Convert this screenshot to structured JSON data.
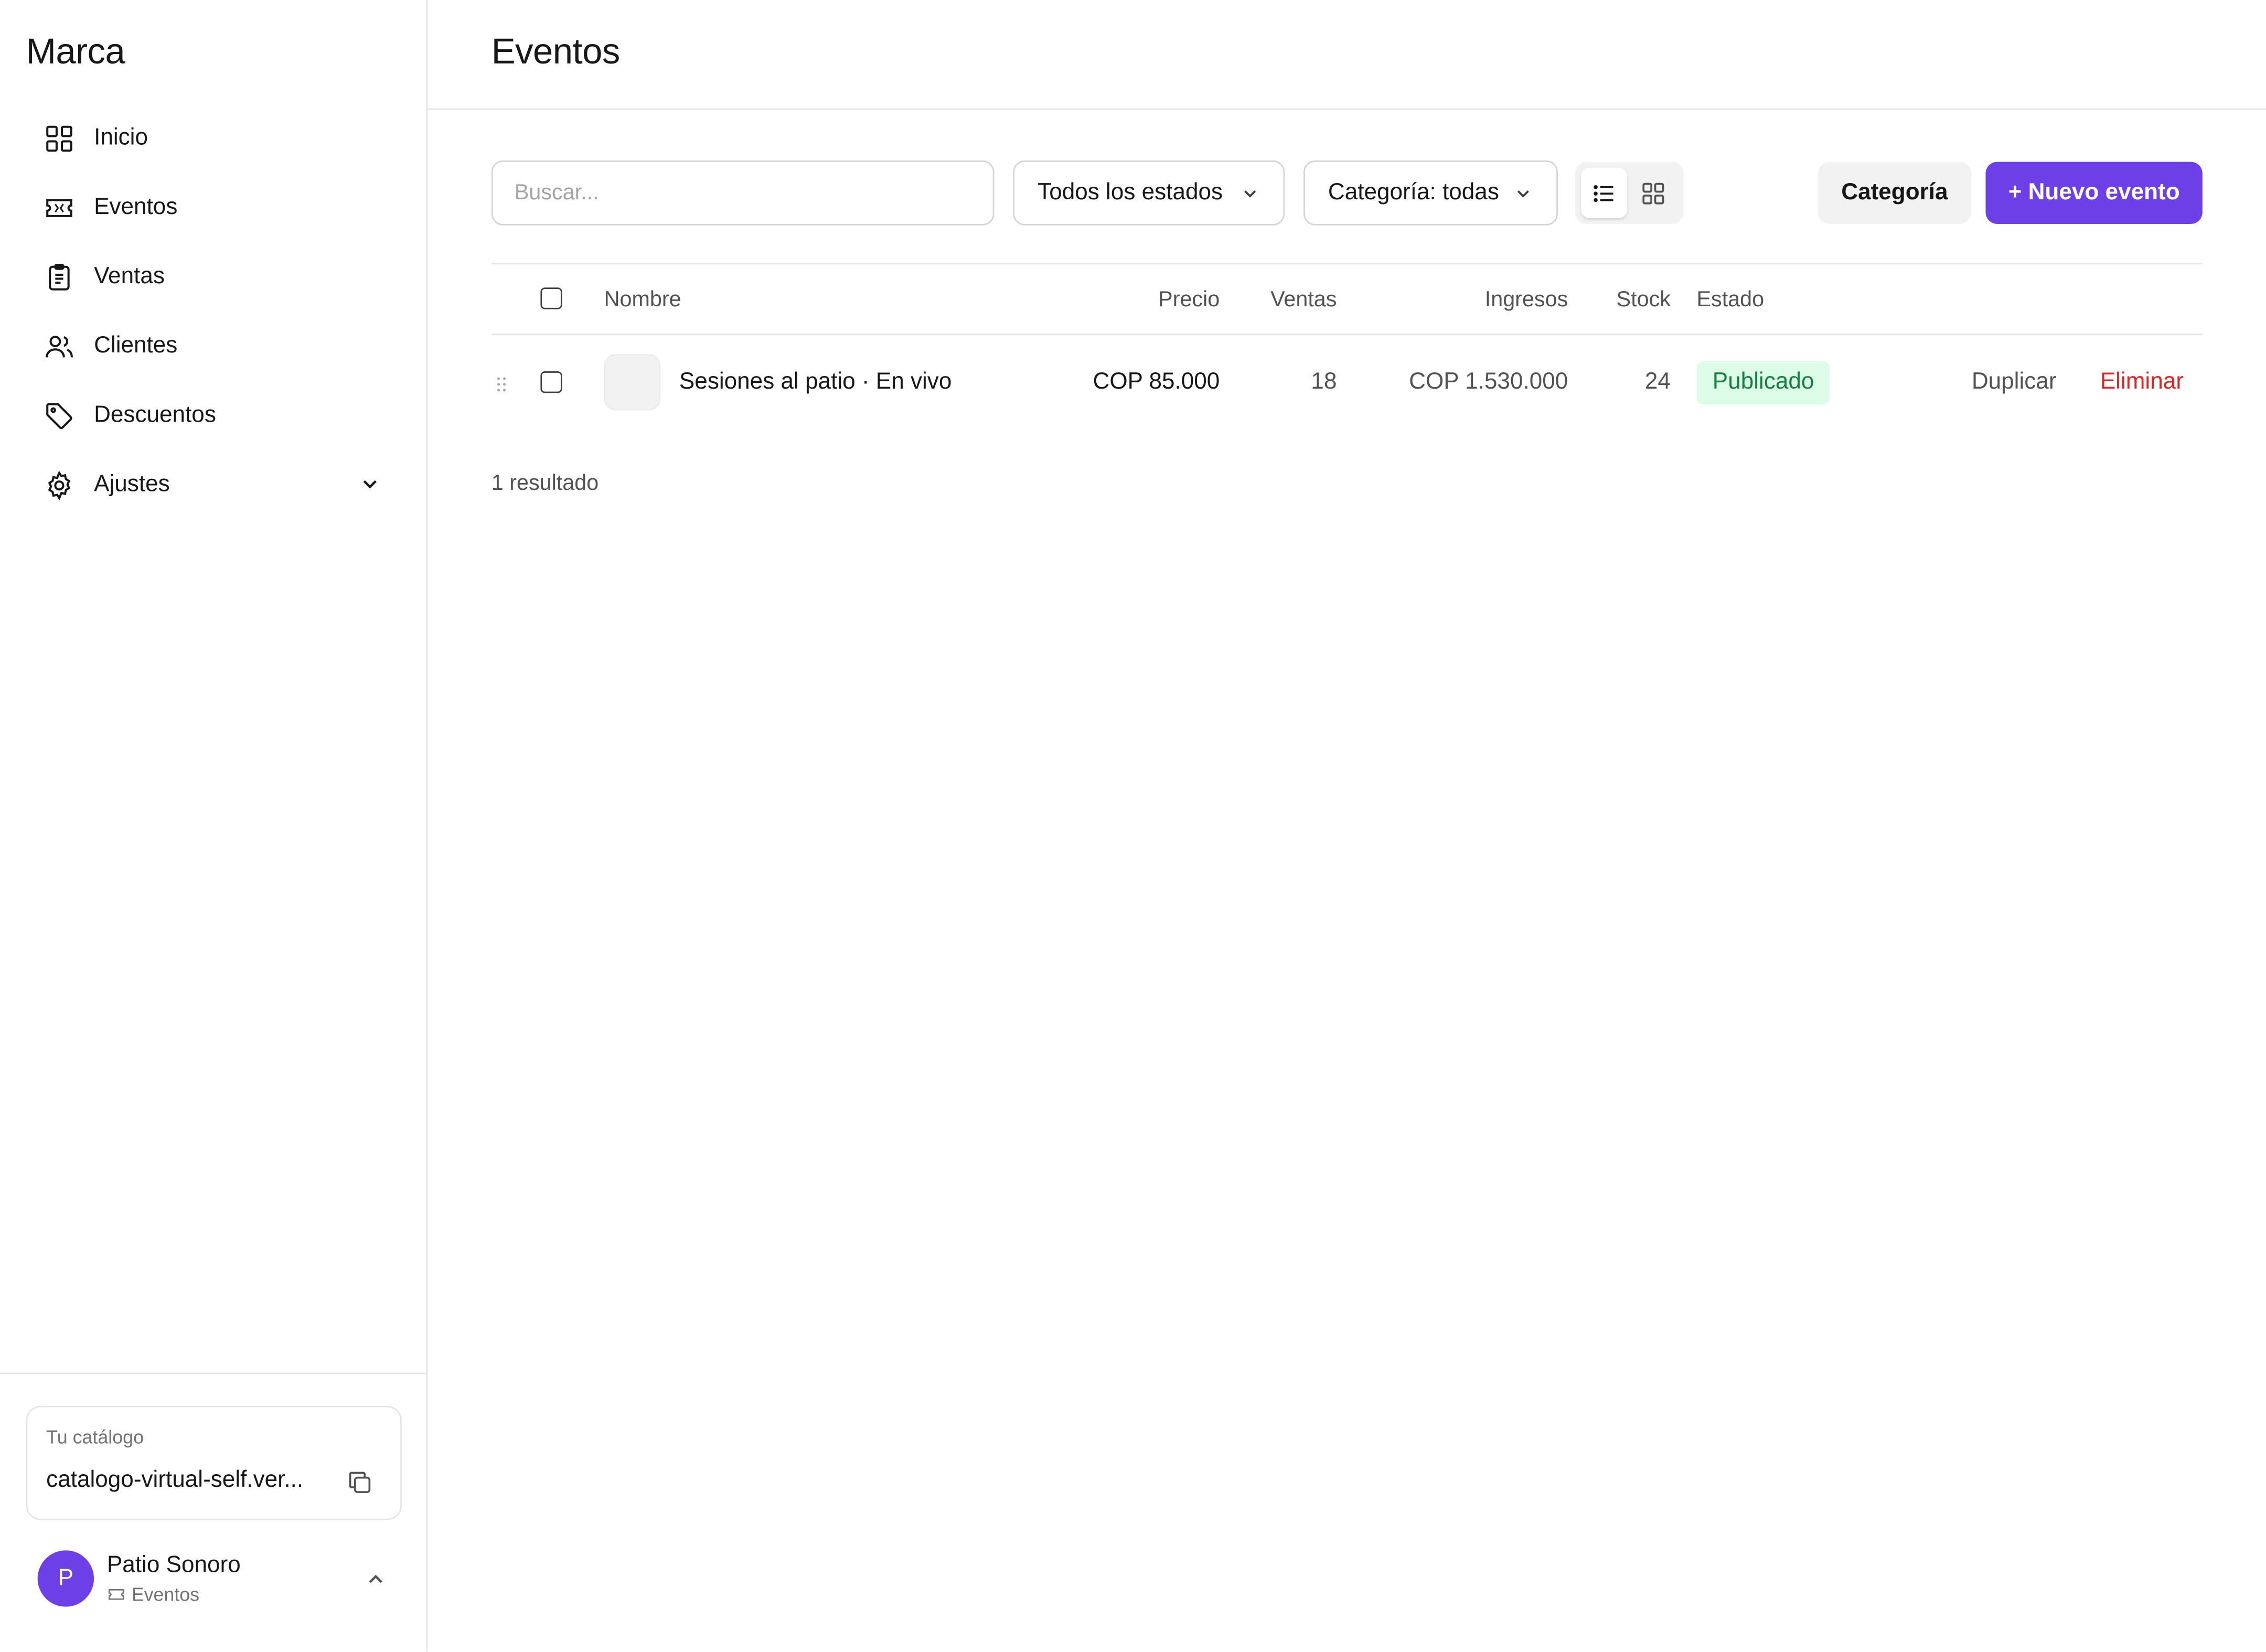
{
  "sidebar": {
    "brand": "Marca",
    "items": [
      {
        "label": "Inicio",
        "icon": "grid-icon"
      },
      {
        "label": "Eventos",
        "icon": "ticket-icon"
      },
      {
        "label": "Ventas",
        "icon": "clipboard-icon"
      },
      {
        "label": "Clientes",
        "icon": "users-icon"
      },
      {
        "label": "Descuentos",
        "icon": "tag-icon"
      },
      {
        "label": "Ajustes",
        "icon": "gear-icon"
      }
    ],
    "catalog": {
      "label": "Tu catálogo",
      "url": "catalogo-virtual-self.ver..."
    },
    "user": {
      "initial": "P",
      "name": "Patio Sonoro",
      "subtitle": "Eventos"
    }
  },
  "header": {
    "title": "Eventos"
  },
  "toolbar": {
    "search_placeholder": "Buscar...",
    "status_filter": "Todos los estados",
    "category_filter": "Categoría: todas",
    "category_button": "Categoría",
    "new_button": "+ Nuevo evento"
  },
  "table": {
    "columns": {
      "name": "Nombre",
      "price": "Precio",
      "sales": "Ventas",
      "income": "Ingresos",
      "stock": "Stock",
      "status": "Estado"
    },
    "rows": [
      {
        "name": "Sesiones al patio · En vivo",
        "price": "COP 85.000",
        "sales": "18",
        "income": "COP 1.530.000",
        "stock": "24",
        "status": "Publicado",
        "duplicate": "Duplicar",
        "delete": "Eliminar"
      }
    ]
  },
  "result_count": "1 resultado",
  "colors": {
    "accent": "#6d3fe6",
    "status_published_bg": "#dcfce7",
    "status_published_text": "#15803d",
    "danger": "#dc2626"
  }
}
